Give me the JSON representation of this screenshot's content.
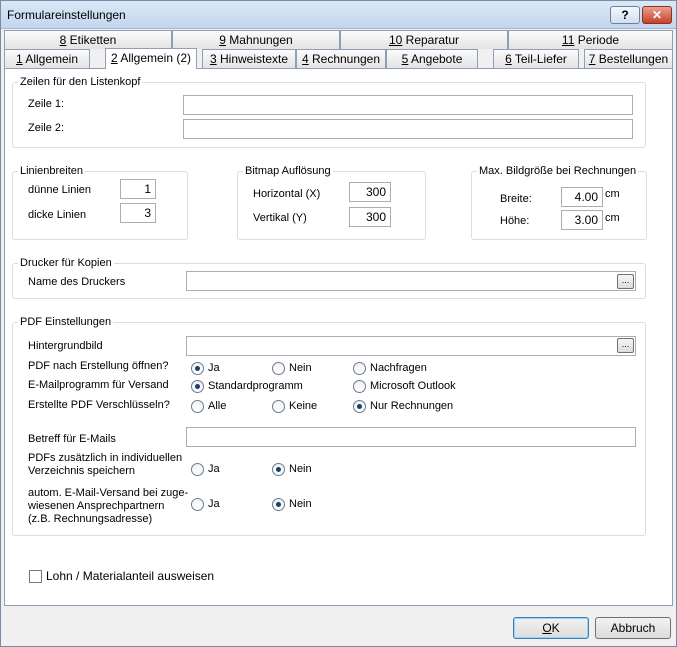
{
  "window": {
    "title": "Formulareinstellungen",
    "help_label": "?",
    "close_label": "✕"
  },
  "tabs_top": [
    {
      "key": "8",
      "label": " Etiketten"
    },
    {
      "key": "9",
      "label": " Mahnungen"
    },
    {
      "key": "10",
      "label": " Reparatur"
    },
    {
      "key": "11",
      "label": " Periode"
    }
  ],
  "tabs_bottom": [
    {
      "key": "1",
      "label": " Allgemein"
    },
    {
      "key": "2",
      "label": " Allgemein (2)",
      "active": true
    },
    {
      "key": "3",
      "label": " Hinweistexte"
    },
    {
      "key": "4",
      "label": " Rechnungen"
    },
    {
      "key": "5",
      "label": " Angebote"
    },
    {
      "key": "6",
      "label": " Teil-Liefer"
    },
    {
      "key": "7",
      "label": " Bestellungen"
    }
  ],
  "listenkopf": {
    "legend": "Zeilen für den Listenkopf",
    "zeile1_label": "Zeile 1:",
    "zeile1_value": "",
    "zeile2_label": "Zeile 2:",
    "zeile2_value": ""
  },
  "linienbreiten": {
    "legend": "Linienbreiten",
    "duenn_label": "dünne Linien",
    "duenn_value": "1",
    "dick_label": "dicke Linien",
    "dick_value": "3"
  },
  "bitmap": {
    "legend": "Bitmap Auflösung",
    "horizontal_label": "Horizontal (X)",
    "horizontal_value": "300",
    "vertikal_label": "Vertikal (Y)",
    "vertikal_value": "300"
  },
  "bildgroesse": {
    "legend": "Max. Bildgröße bei Rechnungen",
    "breite_label": "Breite:",
    "breite_value": "4.00",
    "hoehe_label": "Höhe:",
    "hoehe_value": "3.00",
    "unit": "cm"
  },
  "drucker": {
    "legend": "Drucker für Kopien",
    "name_label": "Name des Druckers",
    "name_value": "",
    "browse_label": "..."
  },
  "pdf": {
    "legend": "PDF Einstellungen",
    "hintergrund_label": "Hintergrundbild",
    "hintergrund_value": "",
    "browse_label": "...",
    "oeffnen_label": "PDF nach Erstellung öffnen?",
    "oeffnen_options": [
      "Ja",
      "Nein",
      "Nachfragen"
    ],
    "oeffnen_selected": 0,
    "email_label": "E-Mailprogramm für Versand",
    "email_options": [
      "Standardprogramm",
      "Microsoft Outlook"
    ],
    "email_selected": 0,
    "verschl_label": "Erstellte PDF Verschlüsseln?",
    "verschl_options": [
      "Alle",
      "Keine",
      "Nur Rechnungen"
    ],
    "verschl_selected": 2,
    "betreff_label": "Betreff für E-Mails",
    "betreff_value": "",
    "zusaetzlich_label_1": "PDFs zusätzlich in individuellen",
    "zusaetzlich_label_2": "Verzeichnis speichern",
    "zusaetzlich_options": [
      "Ja",
      "Nein"
    ],
    "zusaetzlich_selected": 1,
    "autom_label_1": "autom. E-Mail-Versand bei zuge-",
    "autom_label_2": "wiesenen Ansprechpartnern",
    "autom_label_3": "(z.B. Rechnungsadresse)",
    "autom_options": [
      "Ja",
      "Nein"
    ],
    "autom_selected": 1
  },
  "lohn_checkbox_label": "Lohn / Materialanteil ausweisen",
  "lohn_checked": false,
  "buttons": {
    "ok_key": "O",
    "ok_rest": "K",
    "cancel_label": "Abbruch"
  }
}
